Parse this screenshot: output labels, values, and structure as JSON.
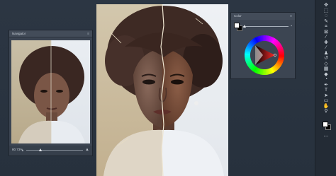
{
  "navigator": {
    "title": "Navigator",
    "menu_icon": "menu-icon",
    "zoom_value": "80.73%",
    "zoom_fraction": 0.25,
    "small_zoom_icon": "zoom-out-mountain-icon",
    "large_zoom_icon": "zoom-in-mountain-icon"
  },
  "color_panel": {
    "title": "Color",
    "menu_icon": "menu-icon",
    "foreground_color": "#ffffff",
    "background_color": "#000000",
    "hue_fraction": 0.03
  },
  "toolbar": {
    "tools": [
      {
        "name": "move-tool-icon",
        "glyph": "✥"
      },
      {
        "name": "marquee-tool-icon",
        "glyph": "⬚"
      },
      {
        "name": "lasso-tool-icon",
        "glyph": "◌"
      },
      {
        "name": "quick-select-tool-icon",
        "glyph": "✎"
      },
      {
        "name": "crop-tool-icon",
        "glyph": "⌗"
      },
      {
        "name": "frame-tool-icon",
        "glyph": "⊠"
      },
      {
        "name": "eyedropper-tool-icon",
        "glyph": "⁄"
      },
      {
        "name": "healing-brush-icon",
        "glyph": "✚"
      },
      {
        "name": "brush-tool-icon",
        "glyph": "∕"
      },
      {
        "name": "clone-stamp-icon",
        "glyph": "♟"
      },
      {
        "name": "history-brush-icon",
        "glyph": "↺"
      },
      {
        "name": "eraser-tool-icon",
        "glyph": "◇"
      },
      {
        "name": "gradient-tool-icon",
        "glyph": "▦"
      },
      {
        "name": "blur-tool-icon",
        "glyph": "◆"
      },
      {
        "name": "dodge-tool-icon",
        "glyph": "◔"
      },
      {
        "name": "pen-tool-icon",
        "glyph": "✒"
      },
      {
        "name": "type-tool-icon",
        "glyph": "T"
      },
      {
        "name": "path-select-icon",
        "glyph": "➤"
      },
      {
        "name": "shape-tool-icon",
        "glyph": "▭"
      },
      {
        "name": "hand-tool-icon",
        "glyph": "✋"
      },
      {
        "name": "zoom-tool-icon",
        "glyph": "⚲"
      },
      {
        "name": "more-tools-icon",
        "glyph": "⋯"
      }
    ],
    "foreground_color": "#ffffff",
    "background_color": "#000000"
  }
}
